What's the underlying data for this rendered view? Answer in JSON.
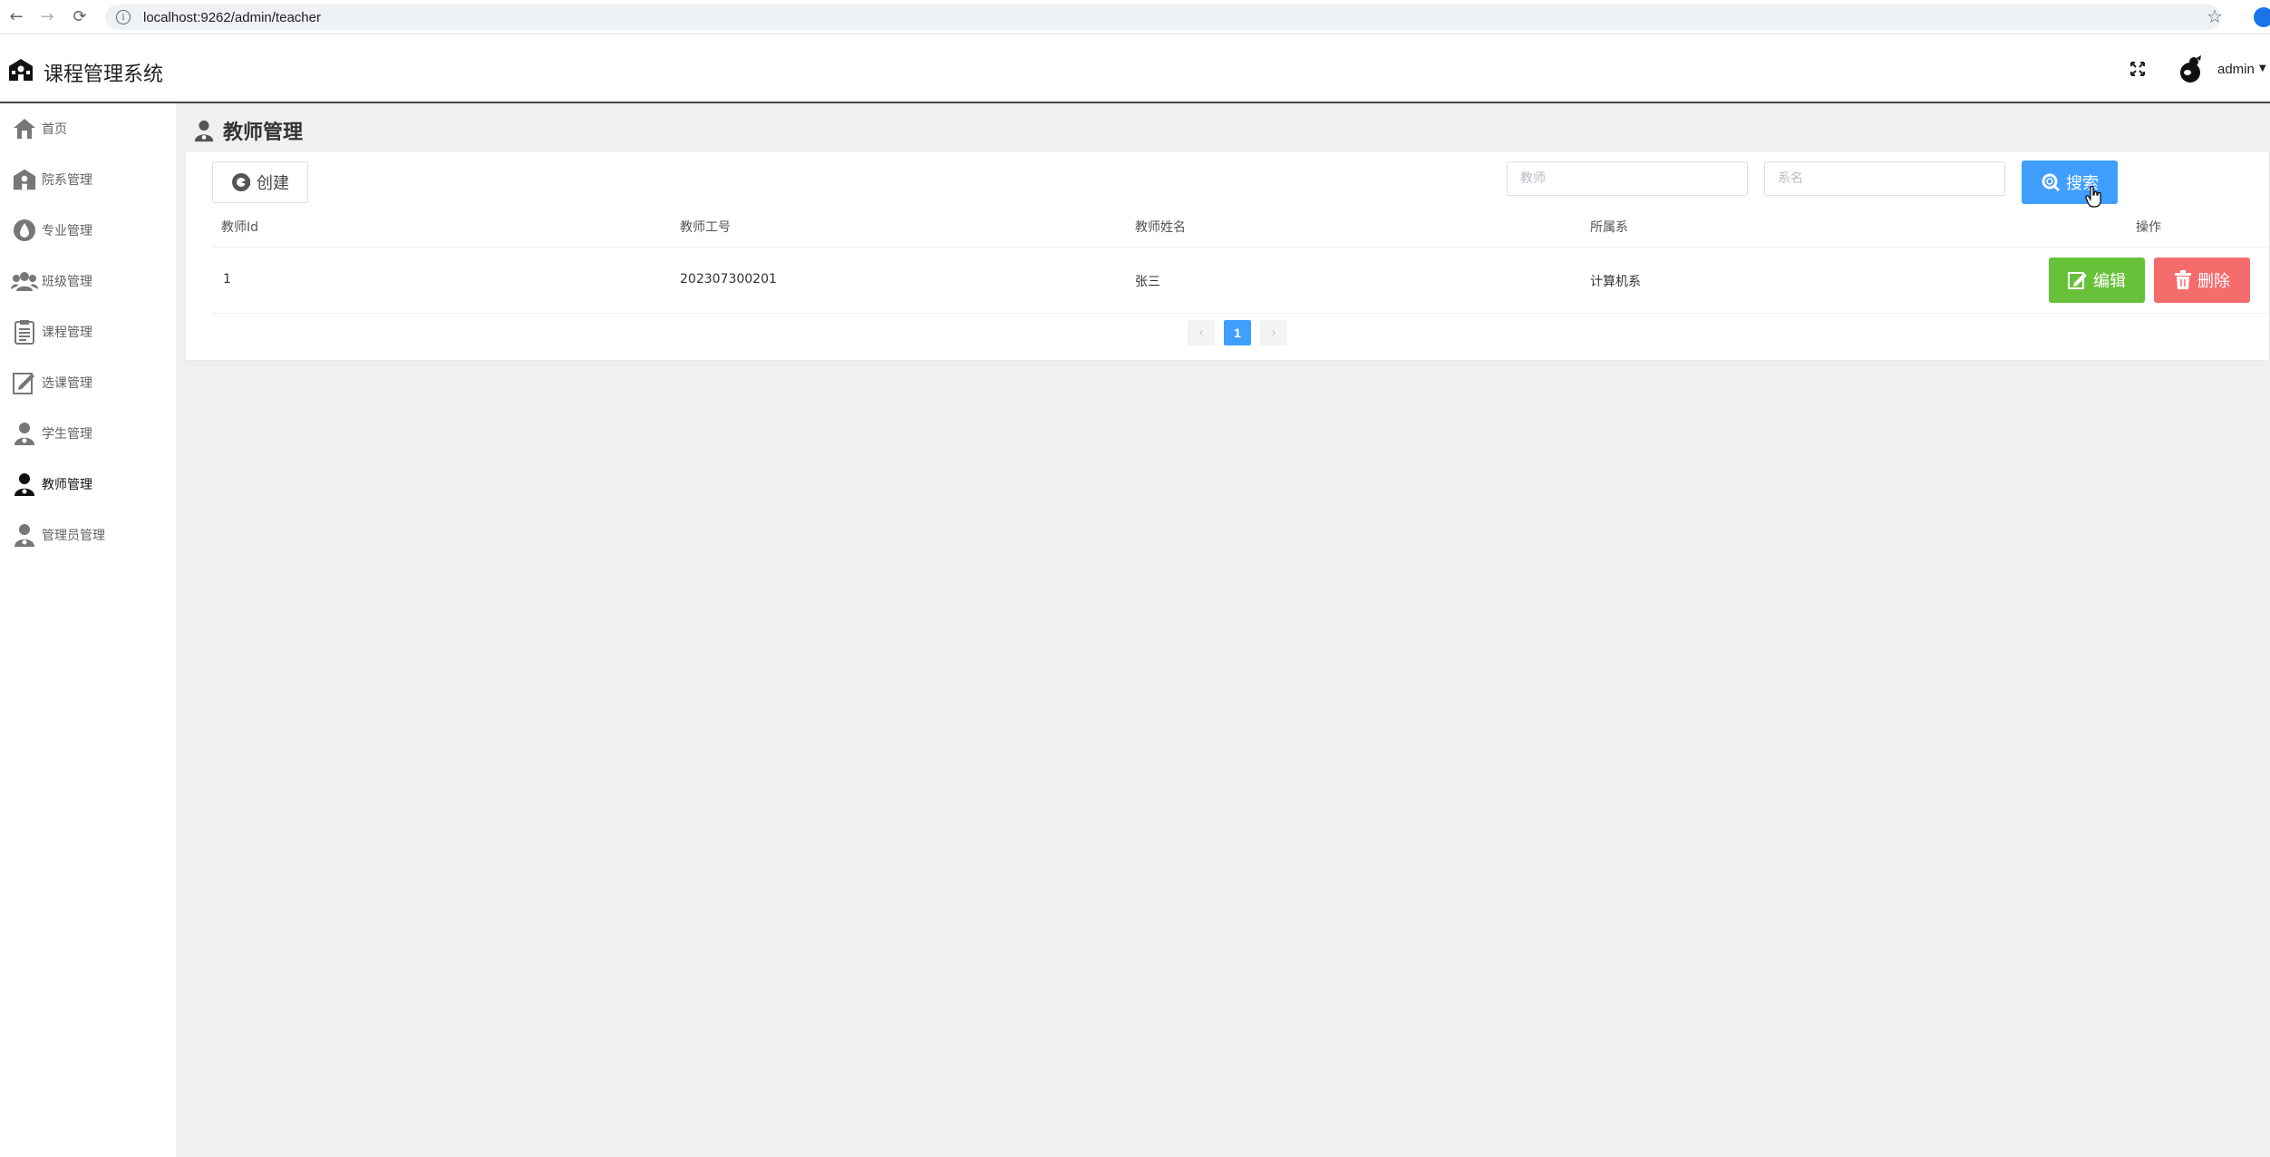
{
  "browser": {
    "url": "localhost:9262/admin/teacher"
  },
  "app": {
    "title": "课程管理系统",
    "user": "admin"
  },
  "sidebar": {
    "items": [
      {
        "label": "首页",
        "icon": "home-icon"
      },
      {
        "label": "院系管理",
        "icon": "school-icon"
      },
      {
        "label": "专业管理",
        "icon": "drop-icon"
      },
      {
        "label": "班级管理",
        "icon": "group-icon"
      },
      {
        "label": "课程管理",
        "icon": "clipboard-icon"
      },
      {
        "label": "选课管理",
        "icon": "edit-note-icon"
      },
      {
        "label": "学生管理",
        "icon": "user-icon"
      },
      {
        "label": "教师管理",
        "icon": "teacher-icon"
      },
      {
        "label": "管理员管理",
        "icon": "admin-icon"
      }
    ],
    "active": "教师管理"
  },
  "main": {
    "page_title": "教师管理",
    "create_label": "创建",
    "search": {
      "teacher_placeholder": "教师",
      "dept_placeholder": "系名",
      "button_label": "搜索"
    },
    "table": {
      "headers": [
        "教师Id",
        "教师工号",
        "教师姓名",
        "所属系",
        "操作"
      ],
      "rows": [
        {
          "id": "1",
          "number": "202307300201",
          "name": "张三",
          "dept": "计算机系"
        }
      ],
      "edit_label": "编辑",
      "delete_label": "删除"
    },
    "pagination": {
      "current": "1",
      "prev": "‹",
      "next": "›"
    }
  },
  "colors": {
    "primary": "#409eff",
    "success": "#67c23a",
    "danger": "#f56c6c"
  }
}
